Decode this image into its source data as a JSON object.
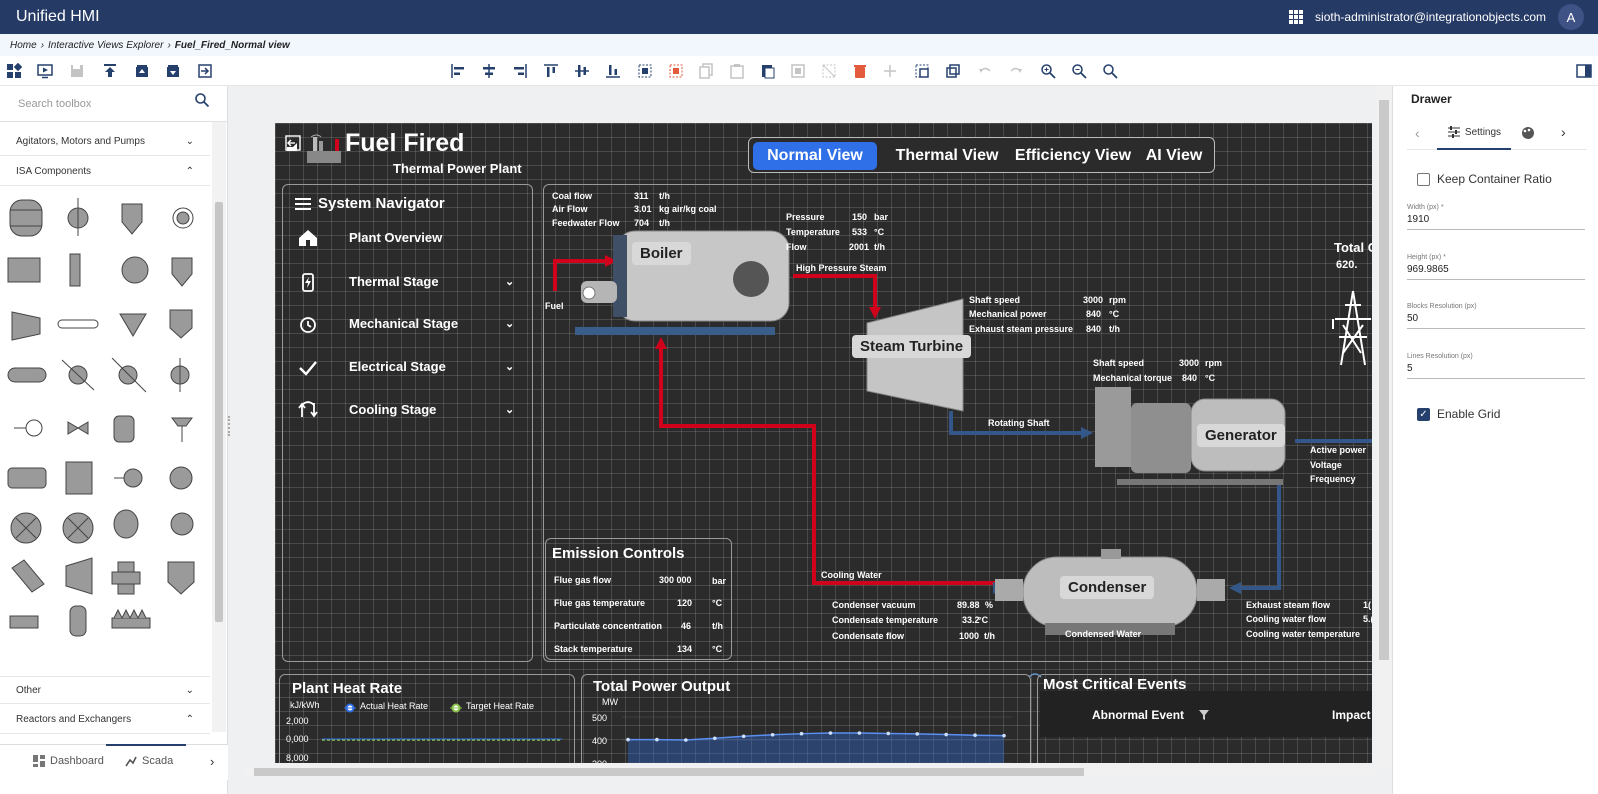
{
  "header": {
    "app_title": "Unified HMI",
    "user": "sioth-administrator@integrationobjects.com",
    "avatar_letter": "A"
  },
  "breadcrumb": {
    "items": [
      "Home",
      "Interactive Views Explorer"
    ],
    "current": "Fuel_Fired_Normal view"
  },
  "toolbox": {
    "search_placeholder": "Search toolbox",
    "sections": [
      {
        "label": "Agitators, Motors and Pumps",
        "expanded": false
      },
      {
        "label": "ISA Components",
        "expanded": true
      },
      {
        "label": "Other",
        "expanded": false
      },
      {
        "label": "Reactors and Exchangers",
        "expanded": true
      }
    ],
    "bottom_tabs": [
      {
        "label": "Dashboard"
      },
      {
        "label": "Scada"
      }
    ]
  },
  "hmi": {
    "title": "Fuel Fired",
    "subtitle": "Thermal Power Plant",
    "view_tabs": [
      "Normal View",
      "Thermal View",
      "Efficiency View",
      "AI View"
    ],
    "active_view": "Normal View",
    "navigator": {
      "title": "System Navigator",
      "items": [
        "Plant Overview",
        "Thermal Stage",
        "Mechanical Stage",
        "Electrical Stage",
        "Cooling Stage"
      ]
    },
    "inputs": [
      {
        "label": "Coal flow",
        "value": "311",
        "unit": "t/h"
      },
      {
        "label": "Air Flow",
        "value": "3.01",
        "unit": "kg air/kg coal"
      },
      {
        "label": "Feedwater Flow",
        "value": "704",
        "unit": "t/h"
      }
    ],
    "fuel_label": "Fuel",
    "boiler": {
      "label": "Boiler",
      "rows": [
        {
          "label": "Pressure",
          "value": "150",
          "unit": "bar"
        },
        {
          "label": "Temperature",
          "value": "533",
          "unit": "°C"
        },
        {
          "label": "Flow",
          "value": "2001",
          "unit": "t/h"
        }
      ],
      "steam_label": "High Pressure Steam"
    },
    "turbine": {
      "label": "Steam Turbine",
      "rows": [
        {
          "label": "Shaft speed",
          "value": "3000",
          "unit": "rpm"
        },
        {
          "label": "Mechanical power",
          "value": "840",
          "unit": "°C"
        },
        {
          "label": "Exhaust steam pressure",
          "value": "840",
          "unit": "t/h"
        }
      ],
      "shaft_label": "Rotating Shaft"
    },
    "generator": {
      "label": "Generator",
      "rows": [
        {
          "label": "Shaft speed",
          "value": "3000",
          "unit": "rpm"
        },
        {
          "label": "Mechanical torque",
          "value": "840",
          "unit": "°C"
        }
      ],
      "outputs": [
        "Active power",
        "Voltage",
        "Frequency"
      ]
    },
    "total_partial": {
      "label": "Total C",
      "value": "620."
    },
    "condenser": {
      "label": "Condenser",
      "cooling_water_label": "Cooling Water",
      "condensed_water_label": "Condensed Water",
      "rows": [
        {
          "label": "Condenser vacuum",
          "value": "89.88",
          "unit": "%"
        },
        {
          "label": "Condensate temperature",
          "value": "33.2",
          "unit": "°C"
        },
        {
          "label": "Condensate flow",
          "value": "1000",
          "unit": "t/h"
        }
      ],
      "right_rows": [
        {
          "label": "Exhaust steam flow",
          "value": "1("
        },
        {
          "label": "Cooling water flow",
          "value": "5.("
        },
        {
          "label": "Cooling water temperature",
          "value": ""
        }
      ]
    },
    "emission": {
      "title": "Emission Controls",
      "rows": [
        {
          "label": "Flue gas flow",
          "value": "300 000",
          "unit": "bar"
        },
        {
          "label": "Flue gas temperature",
          "value": "120",
          "unit": "°C"
        },
        {
          "label": "Particulate concentration",
          "value": "46",
          "unit": "t/h"
        },
        {
          "label": "Stack temperature",
          "value": "134",
          "unit": "°C"
        }
      ]
    },
    "heat_rate": {
      "title": "Plant Heat Rate",
      "unit": "kJ/kWh",
      "legend": [
        "Actual Heat Rate",
        "Target Heat Rate"
      ],
      "ticks": [
        "2,000",
        "0,000",
        "8,000"
      ]
    },
    "power_output": {
      "title": "Total Power Output",
      "unit": "MW",
      "ticks": [
        "500",
        "400",
        "300"
      ]
    },
    "events": {
      "title": "Most Critical Events",
      "col1": "Abnormal Event",
      "col2": "Impact"
    }
  },
  "chart_data": {
    "type": "line",
    "title": "Total Power Output",
    "ylabel": "MW",
    "ylim": [
      300,
      500
    ],
    "series": [
      {
        "values": [
          398,
          398,
          396,
          404,
          413,
          420,
          425,
          428,
          428,
          426,
          424,
          421,
          418,
          416
        ]
      }
    ]
  },
  "drawer": {
    "title": "Drawer",
    "tab_label": "Settings",
    "keep_ratio_label": "Keep Container Ratio",
    "keep_ratio": false,
    "fields": [
      {
        "label": "Width (px) *",
        "value": "1910"
      },
      {
        "label": "Height (px) *",
        "value": "969.9865"
      },
      {
        "label": "Blocks Resolution (px)",
        "value": "50"
      },
      {
        "label": "Lines Resolution (px)",
        "value": "5"
      }
    ],
    "grid_label": "Enable Grid",
    "grid_enabled": true
  },
  "colors": {
    "header": "#263a66",
    "accent": "#2f6fe8",
    "pipe_red": "#d0021b",
    "pipe_blue": "#34578a"
  }
}
